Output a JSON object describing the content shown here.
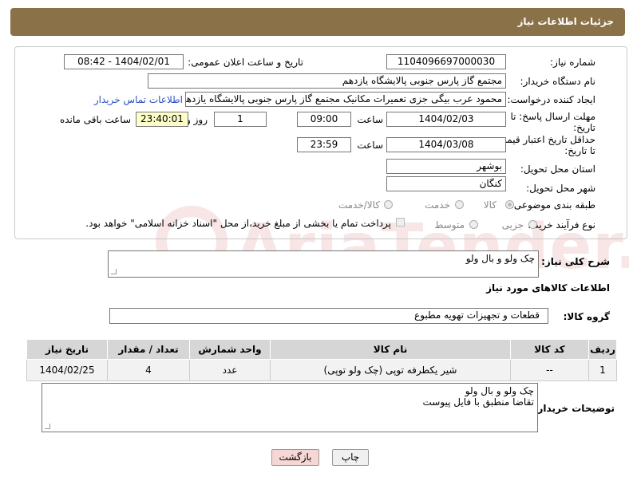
{
  "header": {
    "title": "جزئیات اطلاعات نیاز"
  },
  "form": {
    "need_number_label": "شماره نیاز:",
    "need_number": "1104096697000030",
    "announce_label": "تاریخ و ساعت اعلان عمومی:",
    "announce_value": "1404/02/01 - 08:42",
    "buyer_org_label": "نام دستگاه خریدار:",
    "buyer_org": "مجتمع گاز پارس جنوبی  پالایشگاه یازدهم",
    "requester_label": "ایجاد کننده درخواست:",
    "requester": "محمود عرب بیگی جزی تعمیرات مکانیک مجتمع گاز پارس جنوبی  پالایشگاه یازدهم",
    "contact_link": "اطلاعات تماس خریدار",
    "reply_deadline_label_1": "مهلت ارسال پاسخ: تا",
    "reply_deadline_label_2": "تاریخ:",
    "reply_date": "1404/02/03",
    "time_label": "ساعت",
    "reply_time": "09:00",
    "days_value": "1",
    "days_label": "روز و",
    "remaining_time": "23:40:01",
    "remaining_label": "ساعت باقی مانده",
    "price_deadline_label_1": "حداقل تاریخ اعتبار قیمت:",
    "price_deadline_label_2": "تا تاریخ:",
    "price_date": "1404/03/08",
    "price_time": "23:59",
    "province_label": "استان محل تحویل:",
    "province": "بوشهر",
    "city_label": "شهر محل تحویل:",
    "city": "کنگان",
    "category_label": "طبقه بندی موضوعی:",
    "category_options": [
      "کالا",
      "خدمت",
      "کالا/خدمت"
    ],
    "process_label": "نوع فرآیند خرید :",
    "process_options": [
      "جزیی",
      "متوسط"
    ],
    "payment_note": "پرداخت تمام یا بخشی از مبلغ خرید،از محل \"اسناد خزانه اسلامی\" خواهد بود."
  },
  "description": {
    "label": "شرح کلی نیاز:",
    "value": "چک ولو و بال ولو"
  },
  "goods": {
    "section_title": "اطلاعات کالاهای مورد نیاز",
    "group_label": "گروه کالا:",
    "group_value": "قطعات و تجهیزات تهویه مطبوع",
    "columns": [
      "ردیف",
      "کد کالا",
      "نام کالا",
      "واحد شمارش",
      "تعداد / مقدار",
      "تاریخ نیاز"
    ],
    "rows": [
      [
        "1",
        "--",
        "شیر یکطرفه توپی (چک ولو توپی)",
        "عدد",
        "4",
        "1404/02/25"
      ]
    ]
  },
  "buyer_notes": {
    "label": "توضیحات خریدار:",
    "line1": "چک ولو و بال ولو",
    "line2": "تقاضا منطبق با فایل پیوست"
  },
  "buttons": {
    "print": "چاپ",
    "back": "بازگشت"
  },
  "watermark": {
    "text": "AriaTender.neT"
  },
  "colors": {
    "header": "#8b7148",
    "link": "#2a52be",
    "back_button_bg": "#f7d6d6"
  }
}
